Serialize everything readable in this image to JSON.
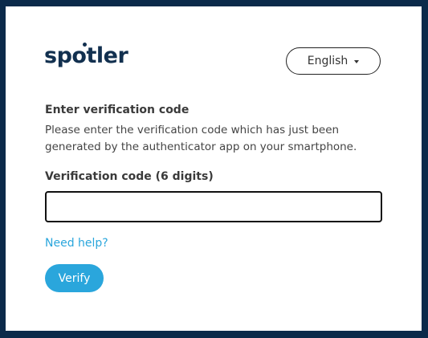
{
  "brand": {
    "logo_text_before": "sp",
    "logo_text_o": "o",
    "logo_text_after": "tler",
    "color": "#12304f"
  },
  "language": {
    "selected": "English",
    "icon": "caret-down-icon"
  },
  "verification": {
    "heading": "Enter verification code",
    "description": "Please enter the verification code which has just been generated by the authenticator app on your smartphone.",
    "field_label": "Verification code (6 digits)",
    "field_value": "",
    "field_placeholder": "",
    "help_link": "Need help?",
    "submit_label": "Verify"
  },
  "colors": {
    "accent": "#2aa6dc",
    "frame_border": "#0b2a4a"
  }
}
